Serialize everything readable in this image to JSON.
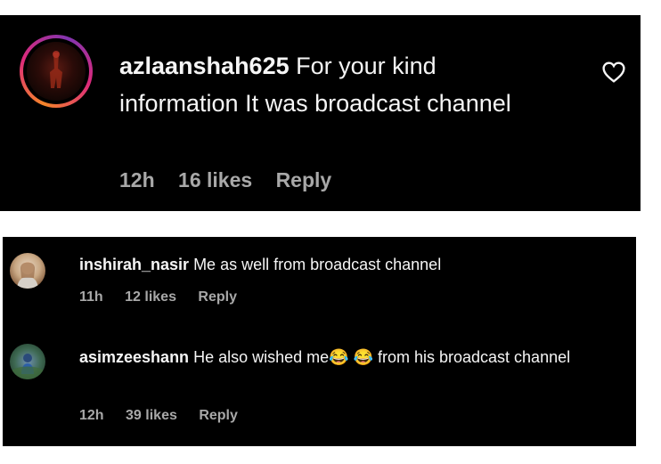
{
  "comments": [
    {
      "username": "azlaanshah625",
      "text": "For your kind information It was broadcast channel",
      "time": "12h",
      "likes": "16 likes",
      "reply": "Reply",
      "avatar_icon": "avatar-with-story-ring"
    },
    {
      "username": "inshirah_nasir",
      "text": "Me as well from broadcast channel",
      "time": "11h",
      "likes": "12 likes",
      "reply": "Reply",
      "avatar_icon": "avatar-photo"
    },
    {
      "username": "asimzeeshann",
      "text_before": "He also wished me",
      "emoji": "😂 😂",
      "text_after": " from his broadcast channel",
      "time": "12h",
      "likes": "39 likes",
      "reply": "Reply",
      "avatar_icon": "avatar-photo"
    }
  ],
  "colors": {
    "panel_bg": "#000000",
    "text": "#f5f5f5",
    "meta": "#a8a8a8"
  }
}
